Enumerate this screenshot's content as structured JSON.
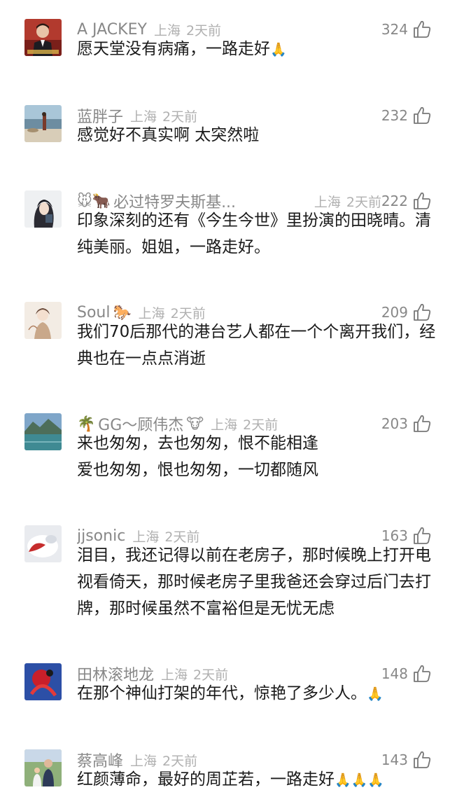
{
  "like_icon": "thumbs-up-outline-icon",
  "comments": [
    {
      "username": "A JACKEY",
      "location": "上海",
      "time": "2天前",
      "likes": "324",
      "text": "愿天堂没有病痛，一路走好",
      "text_emoji": "🙏"
    },
    {
      "username": "蓝胖子",
      "location": "上海",
      "time": "2天前",
      "likes": "232",
      "text": "感觉好不真实啊 太突然啦"
    },
    {
      "username_prefix_emoji": "🐭🐂",
      "username": "必过特罗夫斯基...",
      "location": "上海",
      "time": "2天前",
      "likes": "222",
      "text": "印象深刻的还有《今生今世》里扮演的田晓晴。清纯美丽。姐姐，一路走好。"
    },
    {
      "username": "Soul",
      "username_suffix_emoji": "🐎",
      "location": "上海",
      "time": "2天前",
      "likes": "209",
      "text": "我们70后那代的港台艺人都在一个个离开我们，经典也在一点点消逝"
    },
    {
      "username_prefix_emoji": "🌴",
      "username": "GG～顾伟杰",
      "username_suffix_emoji": "🐮",
      "location": "上海",
      "time": "2天前",
      "likes": "203",
      "text": "来也匆匆，去也匆匆，恨不能相逢\n爱也匆匆，恨也匆匆，一切都随风"
    },
    {
      "username": "jjsonic",
      "location": "上海",
      "time": "2天前",
      "likes": "163",
      "text": "泪目，我还记得以前在老房子，那时候晚上打开电视看倚天，那时候老房子里我爸还会穿过后门去打牌，那时候虽然不富裕但是无忧无虑"
    },
    {
      "username": "田林滚地龙",
      "location": "上海",
      "time": "2天前",
      "likes": "148",
      "text": "在那个神仙打架的年代，惊艳了多少人。",
      "text_emoji": "🙏"
    },
    {
      "username": "蔡高峰",
      "location": "上海",
      "time": "2天前",
      "likes": "143",
      "text": "红颜薄命，最好的周芷若，一路走好",
      "text_emoji": "🙏🙏🙏"
    }
  ]
}
